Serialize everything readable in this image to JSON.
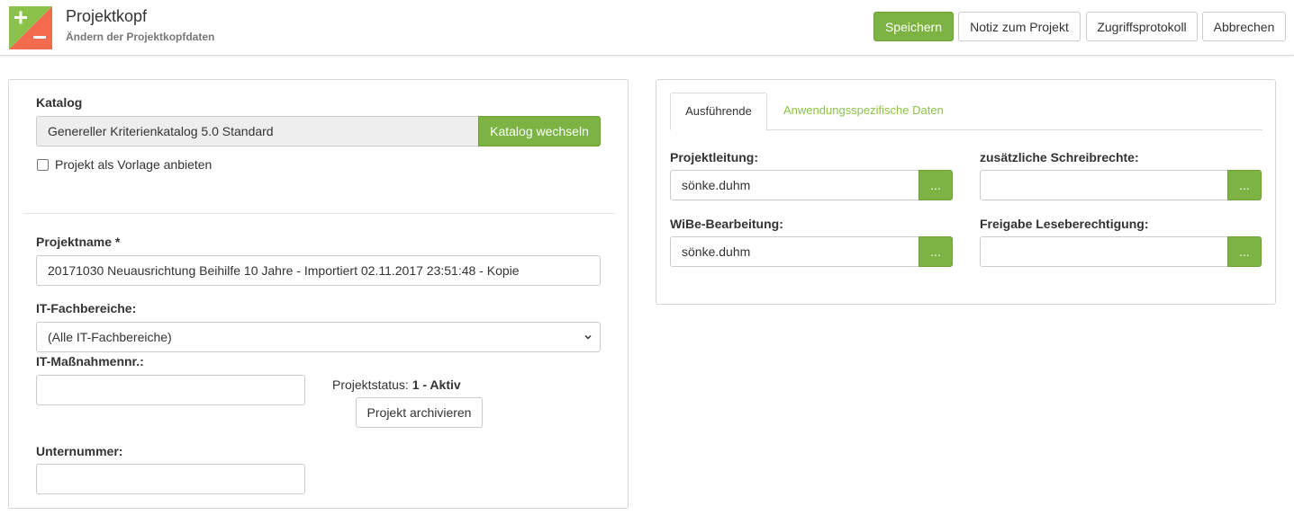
{
  "header": {
    "title": "Projektkopf",
    "subtitle": "Ändern der Projektkopfdaten",
    "buttons": {
      "save": "Speichern",
      "note": "Notiz zum Projekt",
      "access_log": "Zugriffsprotokoll",
      "cancel": "Abbrechen"
    }
  },
  "colors": {
    "accent": "#7cb342",
    "logo_green": "#8bc34a",
    "logo_red": "#f26b4f"
  },
  "left": {
    "catalog": {
      "label": "Katalog",
      "value": "Genereller Kriterienkatalog 5.0  Standard",
      "change_button": "Katalog wechseln",
      "template_checkbox_label": "Projekt als Vorlage anbieten",
      "template_checked": false
    },
    "project_name": {
      "label": "Projektname *",
      "value": "20171030 Neuausrichtung Beihilfe 10 Jahre - Importiert 02.11.2017 23:51:48 - Kopie"
    },
    "it_departments": {
      "label": "IT-Fachbereiche:",
      "selected": "(Alle IT-Fachbereiche)"
    },
    "measure_no": {
      "label": "IT-Maßnahmennr.:",
      "value": ""
    },
    "status": {
      "label": "Projektstatus:",
      "value": "1 - Aktiv",
      "archive_button": "Projekt archivieren"
    },
    "sub_no": {
      "label": "Unternummer:",
      "value": ""
    }
  },
  "right": {
    "tabs": [
      {
        "label": "Ausführende",
        "active": true
      },
      {
        "label": "Anwendungsspezifische Daten",
        "active": false
      }
    ],
    "fields": {
      "project_lead": {
        "label": "Projektleitung:",
        "value": "sönke.duhm",
        "button": "..."
      },
      "write_rights": {
        "label": "zusätzliche Schreibrechte:",
        "value": "",
        "button": "..."
      },
      "wibe": {
        "label": "WiBe-Bearbeitung:",
        "value": "sönke.duhm",
        "button": "..."
      },
      "read_rights": {
        "label": "Freigabe Leseberechtigung:",
        "value": "",
        "button": "..."
      }
    }
  }
}
